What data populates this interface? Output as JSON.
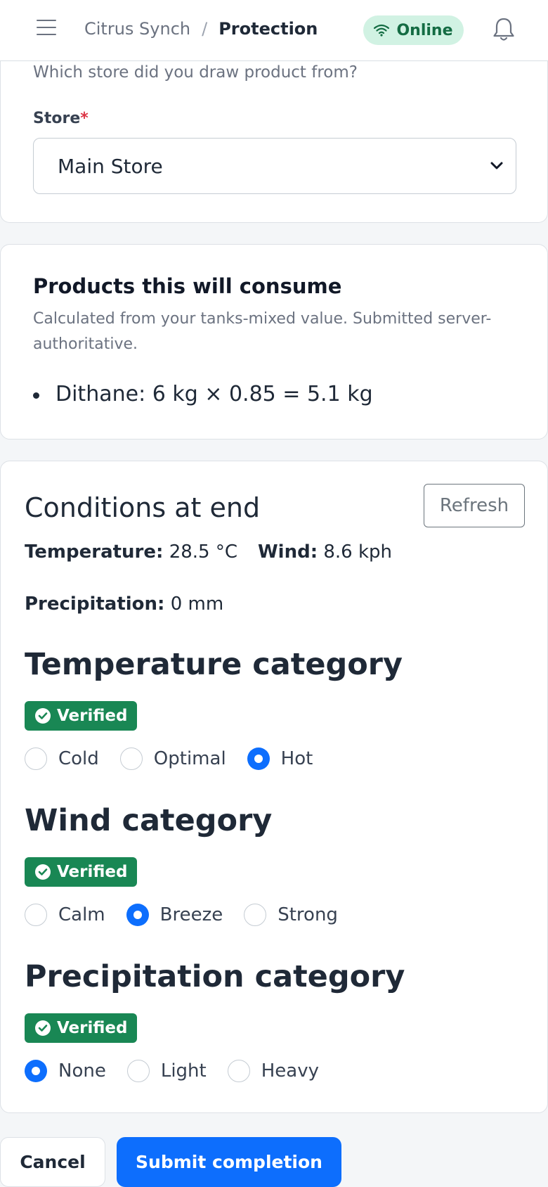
{
  "header": {
    "breadcrumb_parent": "Citrus Synch",
    "breadcrumb_separator": "/",
    "breadcrumb_current": "Protection",
    "status_label": "Online",
    "menu_icon": "hamburger-icon",
    "wifi_icon": "wifi-icon",
    "bell_icon": "bell-icon"
  },
  "store_section": {
    "hint": "Which store did you draw product from?",
    "label": "Store",
    "required_marker": "*",
    "selected": "Main Store"
  },
  "products_section": {
    "title": "Products this will consume",
    "subtitle": "Calculated from your tanks-mixed value. Submitted server-authoritative.",
    "items": [
      "Dithane: 6 kg × 0.85 = 5.1 kg"
    ]
  },
  "conditions": {
    "title": "Conditions at end",
    "refresh_label": "Refresh",
    "temperature_label": "Temperature:",
    "temperature_value": "28.5 °C",
    "wind_label": "Wind:",
    "wind_value": "8.6 kph",
    "precip_label": "Precipitation:",
    "precip_value": "0 mm"
  },
  "categories": [
    {
      "title": "Temperature category",
      "badge": "Verified",
      "options": [
        "Cold",
        "Optimal",
        "Hot"
      ],
      "selected": "Hot"
    },
    {
      "title": "Wind category",
      "badge": "Verified",
      "options": [
        "Calm",
        "Breeze",
        "Strong"
      ],
      "selected": "Breeze"
    },
    {
      "title": "Precipitation category",
      "badge": "Verified",
      "options": [
        "None",
        "Light",
        "Heavy"
      ],
      "selected": "None"
    }
  ],
  "actions": {
    "cancel_label": "Cancel",
    "submit_label": "Submit completion"
  },
  "colors": {
    "primary": "#0d6efd",
    "success": "#198754",
    "online_bg": "#d1f2e3",
    "online_text": "#146c43",
    "required": "#dc3545"
  }
}
